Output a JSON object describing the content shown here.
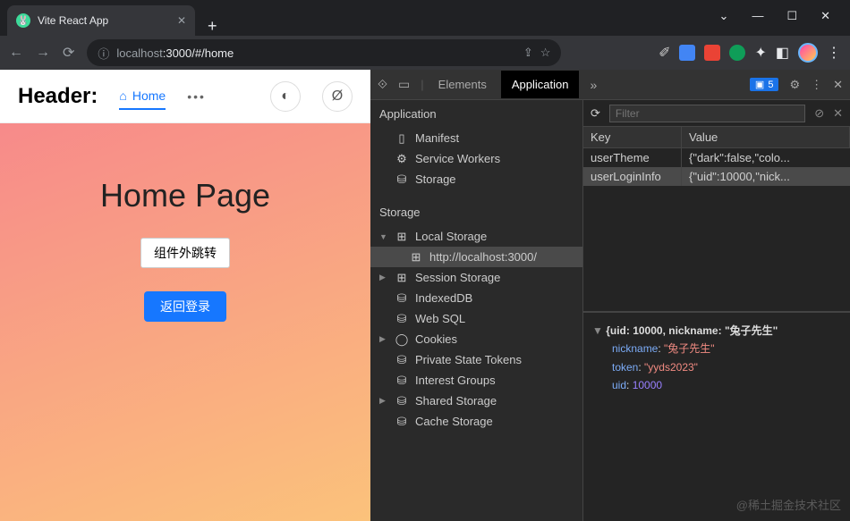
{
  "window": {
    "tab_title": "Vite React App"
  },
  "address": {
    "protocol_host": "localhost",
    "port_path": ":3000/#/home"
  },
  "toolbar_badge": "5",
  "page": {
    "header_label": "Header:",
    "home_link": "Home",
    "title": "Home Page",
    "btn_jump": "组件外跳转",
    "btn_back": "返回登录"
  },
  "devtools": {
    "tabs": {
      "elements": "Elements",
      "application": "Application"
    },
    "sidebar": {
      "app_section": "Application",
      "app_items": [
        "Manifest",
        "Service Workers",
        "Storage"
      ],
      "storage_section": "Storage",
      "local_storage": "Local Storage",
      "local_storage_origin": "http://localhost:3000/",
      "session_storage": "Session Storage",
      "indexeddb": "IndexedDB",
      "websql": "Web SQL",
      "cookies": "Cookies",
      "private_tokens": "Private State Tokens",
      "interest_groups": "Interest Groups",
      "shared_storage": "Shared Storage",
      "cache_storage": "Cache Storage"
    },
    "filter_placeholder": "Filter",
    "table": {
      "key_header": "Key",
      "value_header": "Value",
      "rows": [
        {
          "key": "userTheme",
          "value": "{\"dark\":false,\"colo..."
        },
        {
          "key": "userLoginInfo",
          "value": "{\"uid\":10000,\"nick..."
        }
      ]
    },
    "inspect": {
      "summary": "{uid: 10000, nickname: \"兔子先生\"",
      "nickname_key": "nickname",
      "nickname_val": "\"兔子先生\"",
      "token_key": "token",
      "token_val": "\"yyds2023\"",
      "uid_key": "uid",
      "uid_val": "10000"
    }
  },
  "watermark": "@稀土掘金技术社区"
}
